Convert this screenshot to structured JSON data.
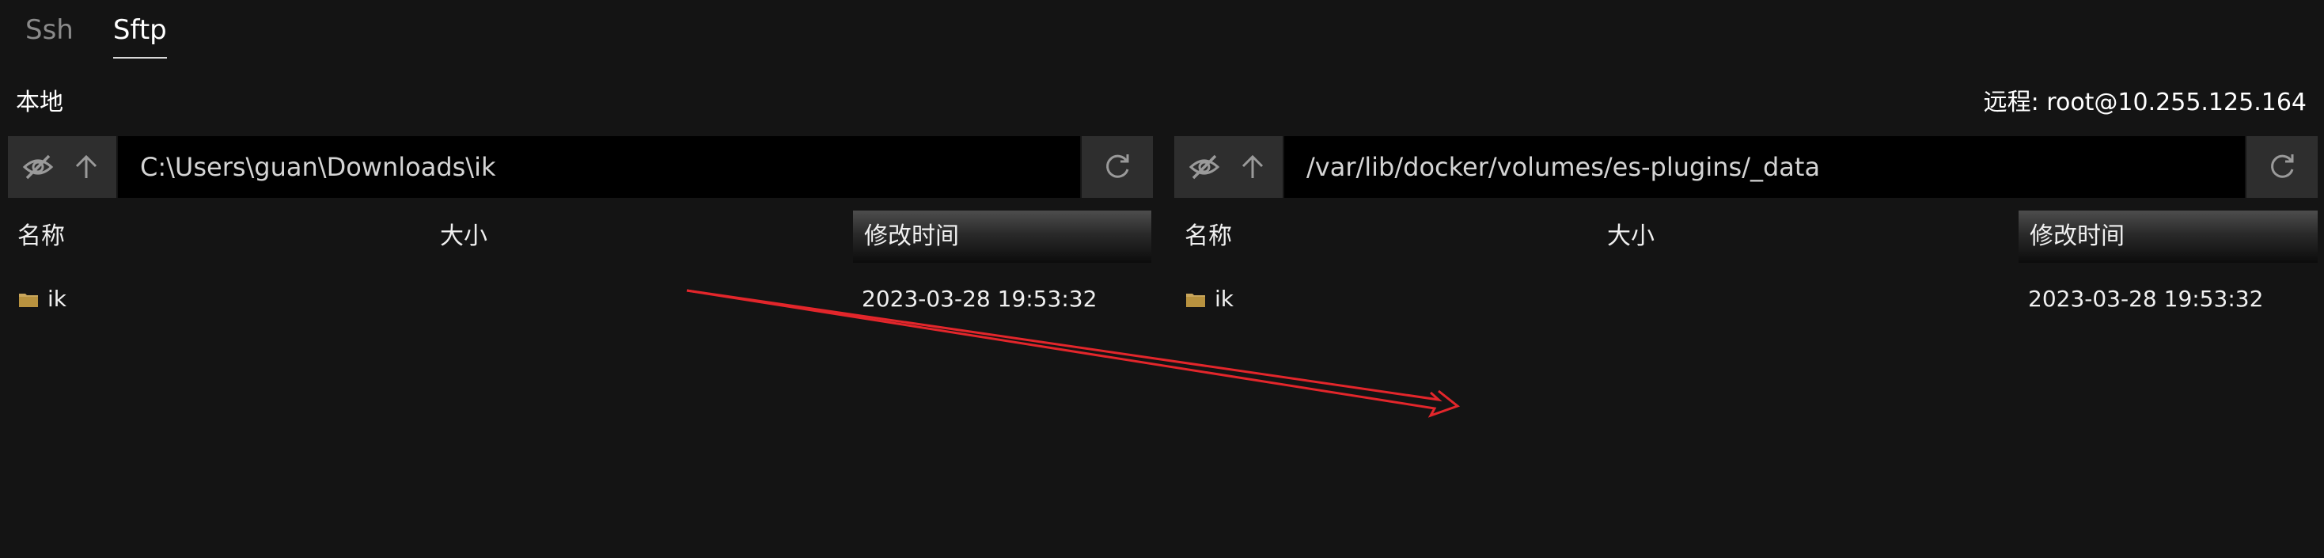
{
  "tabs": [
    {
      "label": "Ssh",
      "active": false
    },
    {
      "label": "Sftp",
      "active": true
    }
  ],
  "local": {
    "label": "本地",
    "path": "C:\\Users\\guan\\Downloads\\ik",
    "columns": {
      "name": "名称",
      "size": "大小",
      "modified": "修改时间"
    },
    "rows": [
      {
        "name": "ik",
        "size": "",
        "modified": "2023-03-28 19:53:32"
      }
    ]
  },
  "remote": {
    "label": "远程: root@10.255.125.164",
    "path": "/var/lib/docker/volumes/es-plugins/_data",
    "columns": {
      "name": "名称",
      "size": "大小",
      "modified": "修改时间"
    },
    "rows": [
      {
        "name": "ik",
        "size": "",
        "modified": "2023-03-28 19:53:32"
      }
    ]
  },
  "icons": {
    "hide": "eye-slash-icon",
    "up": "arrow-up-icon",
    "refresh": "refresh-icon",
    "folder": "folder-icon"
  },
  "colors": {
    "background": "#141414",
    "toolbar": "#2e2e2e",
    "input": "#000000",
    "folder": "#c9a65c",
    "annotation_arrow": "#e3262b"
  }
}
